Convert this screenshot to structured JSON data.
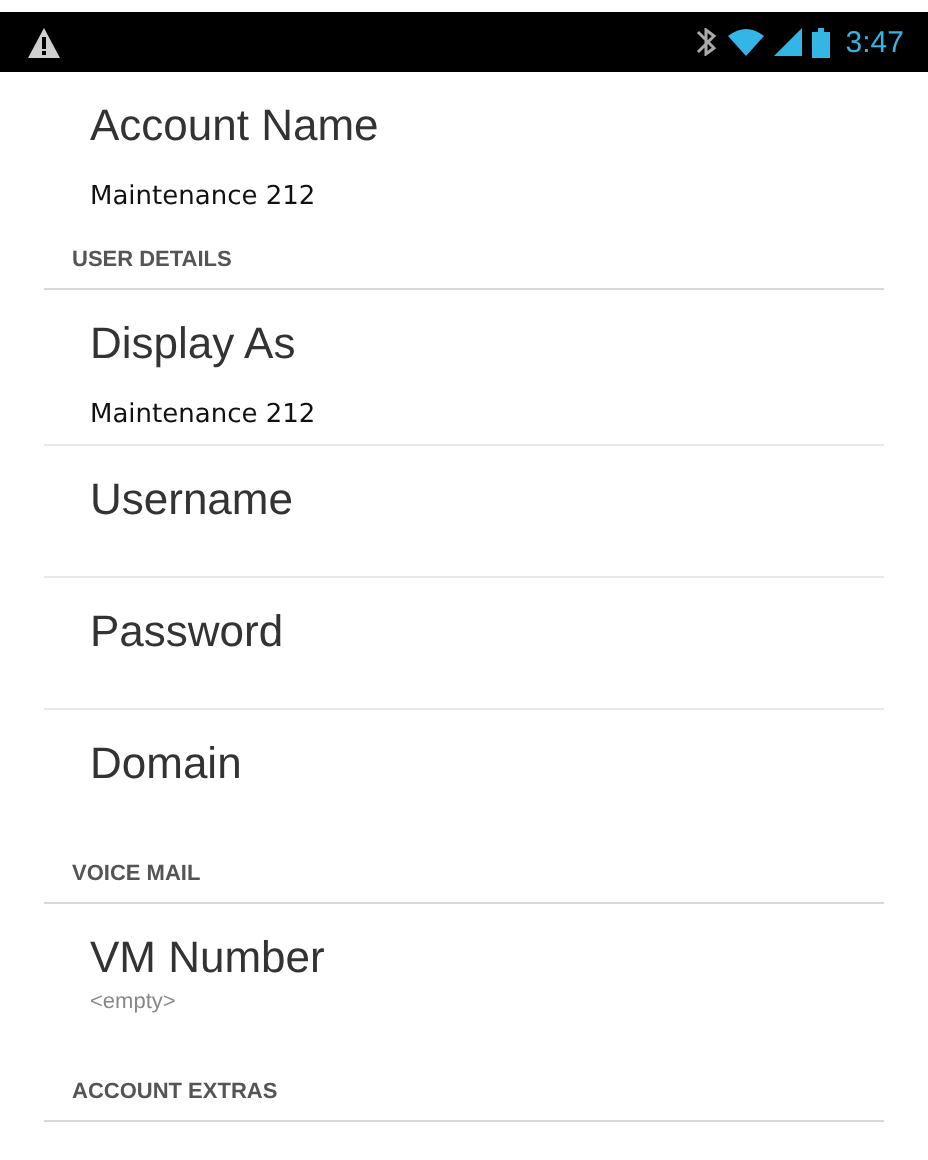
{
  "status_bar": {
    "time": "3:47"
  },
  "items": [
    {
      "kind": "setting",
      "title": "Account Name",
      "summary": "Maintenance 212"
    },
    {
      "kind": "header",
      "title": "USER DETAILS"
    },
    {
      "kind": "setting",
      "title": "Display As",
      "summary": "Maintenance 212"
    },
    {
      "kind": "setting",
      "title": "Username"
    },
    {
      "kind": "setting",
      "title": "Password"
    },
    {
      "kind": "setting",
      "title": "Domain"
    },
    {
      "kind": "header",
      "title": "VOICE MAIL"
    },
    {
      "kind": "setting",
      "title": "VM Number",
      "summary": "<empty>",
      "empty": true
    },
    {
      "kind": "header",
      "title": "ACCOUNT EXTRAS"
    }
  ]
}
